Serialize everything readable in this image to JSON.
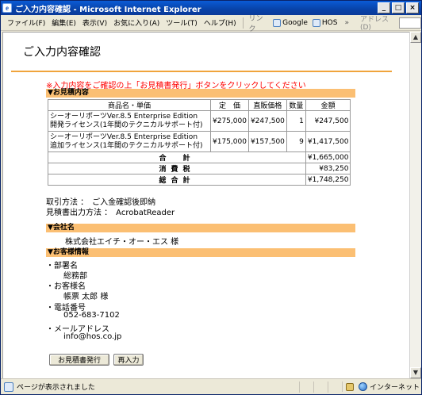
{
  "window": {
    "title": "ご入力内容確認 - Microsoft Internet Explorer",
    "app_icon": "ie-page-icon",
    "buttons": [
      "_",
      "□",
      "×"
    ]
  },
  "menubar": {
    "items": [
      "ファイル(F)",
      "編集(E)",
      "表示(V)",
      "お気に入り(A)",
      "ツール(T)",
      "ヘルプ(H)"
    ],
    "links_label": "リンク",
    "link_google": "Google",
    "link_hos": "HOS",
    "chevron": "»",
    "address_label": "アドレス(D)"
  },
  "page": {
    "title": "ご入力内容確認",
    "notice": "※入力内容をご確認の上「お見積書発行」ボタンをクリックしてください",
    "quote_section": "▼お見積内容",
    "table": {
      "headers": [
        "商品名・単価",
        "定　価",
        "直販価格",
        "数量",
        "金額"
      ],
      "rows": [
        {
          "name_line1": "シーオーリポーツVer.8.5 Enterprise Edition",
          "name_line2": "開発ライセンス(1年間のテクニカルサポート付)",
          "list_price": "¥275,000",
          "direct_price": "¥247,500",
          "qty": "1",
          "amount": "¥247,500"
        },
        {
          "name_line1": "シーオーリポーツVer.8.5 Enterprise Edition",
          "name_line2": "追加ライセンス(1年間のテクニカルサポート付)",
          "list_price": "¥175,000",
          "direct_price": "¥157,500",
          "qty": "9",
          "amount": "¥1,417,500"
        }
      ],
      "subtotal_label": "合　計",
      "subtotal": "¥1,665,000",
      "tax_label": "消費税",
      "tax": "¥83,250",
      "total_label": "総合計",
      "total": "¥1,748,250"
    },
    "payment_line": "取引方法 ：　ご入金確認後即納",
    "output_line": "見積書出力方法 ：　AcrobatReader",
    "company_section": "▼会社名",
    "company_name": "株式会社エイチ・オー・エス 様",
    "customer_section": "▼お客様情報",
    "customer": [
      {
        "label": "・部署名",
        "value": "総務部"
      },
      {
        "label": "・お客様名",
        "value": "帳票 太郎 様"
      },
      {
        "label": "・電話番号",
        "value": "052-683-7102"
      },
      {
        "label": "・メールアドレス",
        "value": "info@hos.co.jp"
      }
    ],
    "issue_button": "お見積書発行",
    "reenter_button": "再入力"
  },
  "statusbar": {
    "text": "ページが表示されました",
    "zone": "インターネット"
  }
}
